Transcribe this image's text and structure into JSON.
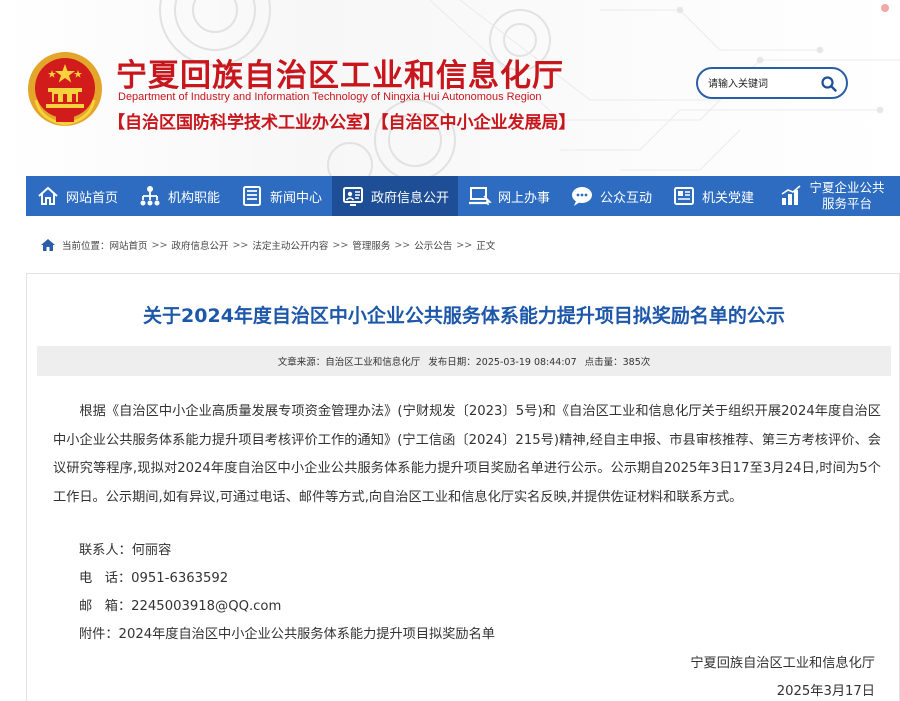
{
  "header": {
    "title_cn": "宁夏回族自治区工业和信息化厅",
    "title_en": "Department of Industry and Information Technology of Ningxia Hui Autonomous Region",
    "sub_orgs": "【自治区国防科学技术工业办公室】【自治区中小企业发展局】",
    "search_placeholder": "请输入关键词",
    "accent_color": "#c8161d"
  },
  "nav": {
    "items": [
      {
        "label": "网站首页",
        "icon": "home-icon"
      },
      {
        "label": "机构职能",
        "icon": "org-chart-icon"
      },
      {
        "label": "新闻中心",
        "icon": "newspaper-icon"
      },
      {
        "label": "政府信息公开",
        "icon": "info-disclosure-icon"
      },
      {
        "label": "网上办事",
        "icon": "computer-icon"
      },
      {
        "label": "公众互动",
        "icon": "chat-bubble-icon"
      },
      {
        "label": "机关党建",
        "icon": "document-icon"
      },
      {
        "label_line1": "宁夏企业公共",
        "label_line2": "服务平台",
        "icon": "bar-chart-icon"
      }
    ],
    "color": "#2d6cc0",
    "active_color": "#1e4f96"
  },
  "breadcrumb": {
    "prefix": "当前位置：",
    "items": [
      "网站首页",
      "政府信息公开",
      "法定主动公开内容",
      "管理服务",
      "公示公告",
      "正文"
    ],
    "separator": ">>"
  },
  "article": {
    "title": "关于2024年度自治区中小企业公共服务体系能力提升项目拟奖励名单的公示",
    "title_color": "#1d57a9",
    "meta": {
      "source_label": "文章来源：自治区工业和信息化厅",
      "date_label": "发布日期：2025-03-19 08:44:07",
      "hits_label": "点击量：385次"
    },
    "paragraph": "根据《自治区中小企业高质量发展专项资金管理办法》(宁财规发〔2023〕5号)和《自治区工业和信息化厅关于组织开展2024年度自治区中小企业公共服务体系能力提升项目考核评价工作的通知》(宁工信函〔2024〕215号)精神,经自主申报、市县审核推荐、第三方考核评价、会议研究等程序,现拟对2024年度自治区中小企业公共服务体系能力提升项目奖励名单进行公示。公示期自2025年3日17至3月24日,时间为5个工作日。公示期间,如有异议,可通过电话、邮件等方式,向自治区工业和信息化厅实名反映,并提供佐证材料和联系方式。",
    "contact": "联系人：何丽容",
    "phone": "电   话：0951-6363592",
    "email": "邮   箱：2245003918@QQ.com",
    "attachment": "附件：2024年度自治区中小企业公共服务体系能力提升项目拟奖励名单",
    "signature": "宁夏回族自治区工业和信息化厅",
    "date": "2025年3月17日"
  }
}
